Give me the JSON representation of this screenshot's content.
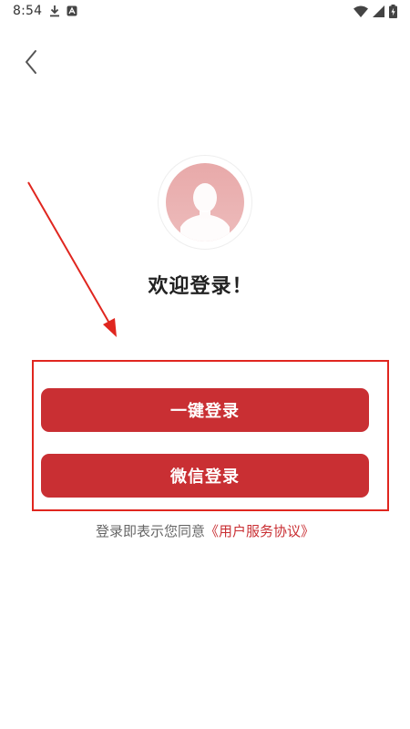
{
  "status_bar": {
    "time": "8:54",
    "icons": [
      "download-icon",
      "app-notification-icon",
      "wifi-icon",
      "signal-icon",
      "battery-charging-icon"
    ]
  },
  "nav": {
    "back_icon": "chevron-left-icon"
  },
  "avatar": {
    "icon": "default-user-silhouette-icon"
  },
  "welcome_title": "欢迎登录！",
  "buttons": {
    "one_click_login": "一键登录",
    "wechat_login": "微信登录"
  },
  "agreement": {
    "prefix": "登录即表示您同意",
    "link_text": "《用户服务协议》"
  },
  "colors": {
    "primary": "#c92f33",
    "annotation": "#e0261f",
    "avatar_bg": "#eab3b3"
  }
}
